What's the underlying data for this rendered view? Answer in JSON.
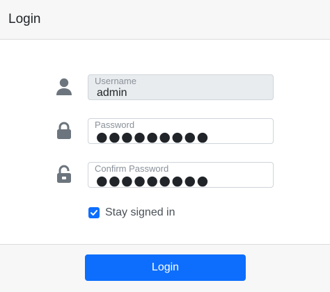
{
  "header": {
    "title": "Login"
  },
  "form": {
    "username": {
      "label": "Username",
      "value": "admin",
      "icon": "user-icon"
    },
    "password": {
      "label": "Password",
      "masked_value": "●●●●●●●●●",
      "icon": "lock-icon"
    },
    "confirm_password": {
      "label": "Confirm Password",
      "masked_value": "●●●●●●●●●",
      "icon": "unlock-icon"
    },
    "stay_signed_in": {
      "label": "Stay signed in",
      "checked": true
    }
  },
  "footer": {
    "login_label": "Login"
  },
  "colors": {
    "accent": "#0d6efd",
    "icon": "#6c757d",
    "header_bg": "#f7f7f7"
  }
}
